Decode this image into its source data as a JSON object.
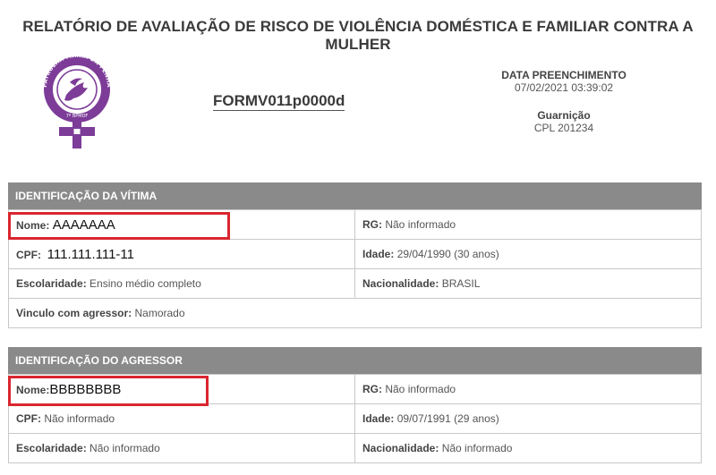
{
  "report": {
    "title_line1": "RELATÓRIO DE AVALIAÇÃO DE RISCO DE VIOLÊNCIA DOMÉSTICA E FAMILIAR CONTRA A",
    "title_line2": "MULHER",
    "form_code": "FORMV011p0000d"
  },
  "logo": {
    "ring_text": "PATRULHA MARIA DA PENHA",
    "bottom_text": "7º BPMDF",
    "color": "#7d3c98"
  },
  "meta": {
    "date_label": "DATA PREENCHIMENTO",
    "date_value": "07/02/2021 03:39:02",
    "unit_label": "Guarnição",
    "unit_value": "CPL 201234"
  },
  "victim": {
    "header": "IDENTIFICAÇÃO DA VÍTIMA",
    "name_label": "Nome:",
    "name_value": "AAAAAAA",
    "rg_label": "RG:",
    "rg_value": "Não informado",
    "cpf_label": "CPF:",
    "cpf_value": "111.111.111-11",
    "age_label": "Idade:",
    "age_value": "29/04/1990 (30 anos)",
    "education_label": "Escolaridade:",
    "education_value": "Ensino médio completo",
    "nationality_label": "Nacionalidade:",
    "nationality_value": "BRASIL",
    "relation_label": "Vinculo com agressor:",
    "relation_value": "Namorado"
  },
  "aggressor": {
    "header": "IDENTIFICAÇÃO DO AGRESSOR",
    "name_label": "Nome:",
    "name_value": "BBBBBBBB",
    "rg_label": "RG:",
    "rg_value": "Não informado",
    "cpf_label": "CPF:",
    "cpf_value": "Não informado",
    "age_label": "Idade:",
    "age_value": "09/07/1991 (29 anos)",
    "education_label": "Escolaridade:",
    "education_value": "Não informado",
    "nationality_label": "Nacionalidade:",
    "nationality_value": "Não informado"
  },
  "highlight_color": "#d9262e"
}
